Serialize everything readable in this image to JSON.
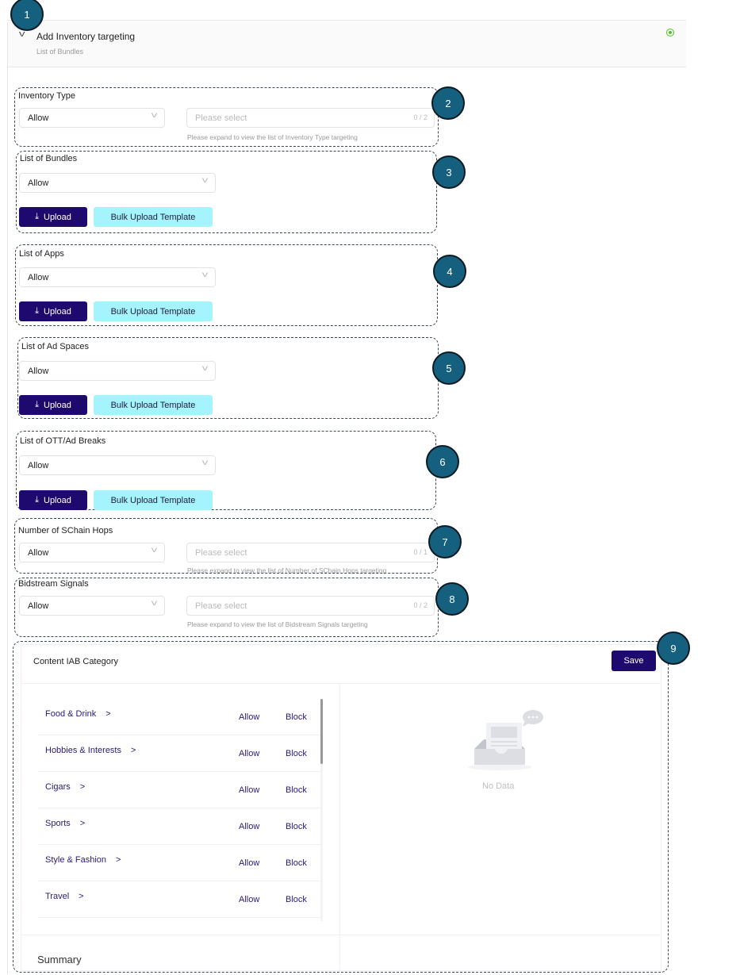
{
  "header": {
    "title": "Add Inventory targeting",
    "subtitle": "List of Bundles",
    "status_icon": "radio-checked-icon",
    "status_color": "#52c41a"
  },
  "colors": {
    "primary": "#1e0a6e",
    "secondary": "#a5f3fc",
    "marker": "#15607f"
  },
  "markers": [
    "1",
    "2",
    "3",
    "4",
    "5",
    "6",
    "7",
    "8",
    "9"
  ],
  "sections": [
    {
      "label": "Inventory Type",
      "mode": "Allow",
      "placeholder": "Please select",
      "count": "0 / 2",
      "hint": "Please expand to view the list of Inventory Type targeting"
    },
    {
      "label": "List of Bundles",
      "mode": "Allow",
      "upload": "Upload",
      "template": "Bulk Upload Template"
    },
    {
      "label": "List of Apps",
      "mode": "Allow",
      "upload": "Upload",
      "template": "Bulk Upload Template"
    },
    {
      "label": "List of Ad Spaces",
      "mode": "Allow",
      "upload": "Upload",
      "template": "Bulk Upload Template"
    },
    {
      "label": "List of OTT/Ad Breaks",
      "mode": "Allow",
      "upload": "Upload",
      "template": "Bulk Upload Template"
    },
    {
      "label": "Number of SChain Hops",
      "mode": "Allow",
      "placeholder": "Please select",
      "count": "0 / 1",
      "hint": "Please expand to view the list of Number of SChain Hops targeting"
    },
    {
      "label": "Bidstream Signals",
      "mode": "Allow",
      "placeholder": "Please select",
      "count": "0 / 2",
      "hint": "Please expand to view the list of Bidstream Signals targeting"
    }
  ],
  "iab": {
    "title": "Content IAB Category",
    "save": "Save",
    "categories": [
      {
        "name": "Food & Drink",
        "allow": "Allow",
        "block": "Block"
      },
      {
        "name": "Hobbies & Interests",
        "allow": "Allow",
        "block": "Block"
      },
      {
        "name": "Cigars",
        "allow": "Allow",
        "block": "Block"
      },
      {
        "name": "Sports",
        "allow": "Allow",
        "block": "Block"
      },
      {
        "name": "Style & Fashion",
        "allow": "Allow",
        "block": "Block"
      },
      {
        "name": "Travel",
        "allow": "Allow",
        "block": "Block"
      }
    ],
    "empty_text": "No Data",
    "summary": "Summary"
  }
}
